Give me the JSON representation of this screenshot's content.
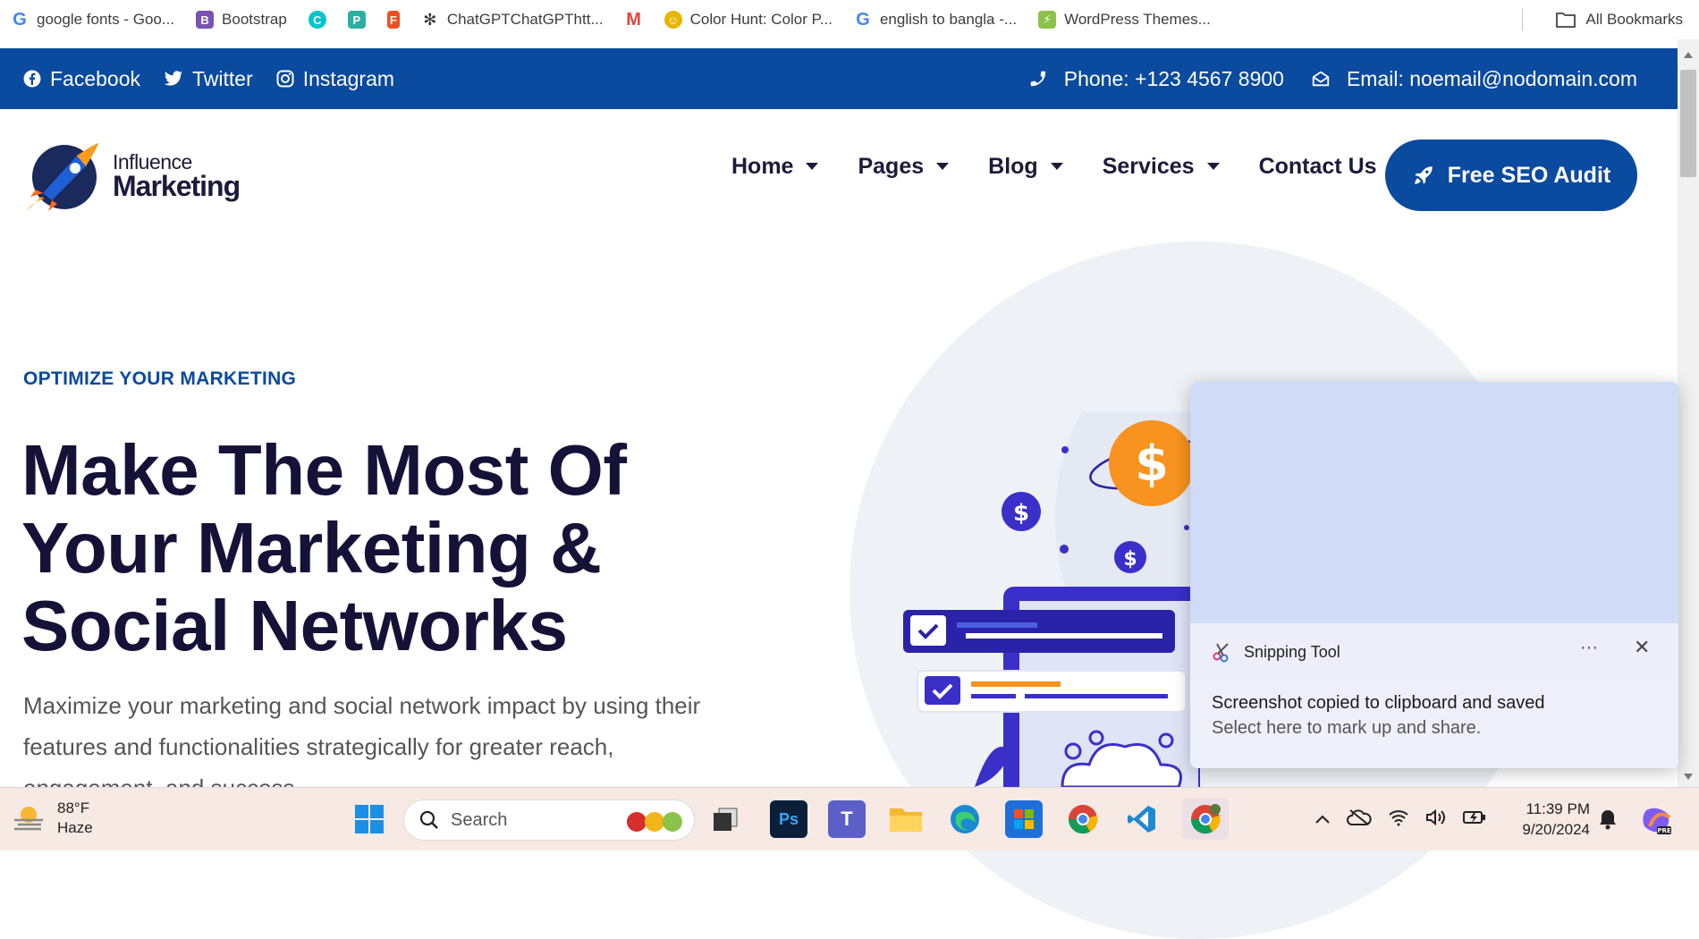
{
  "bookmarks": {
    "items": [
      {
        "label": "google fonts - Goo...",
        "icon": "google-icon",
        "color": "#4285f4"
      },
      {
        "label": "Bootstrap",
        "icon": "bootstrap-icon",
        "color": "#7952b3"
      },
      {
        "label": "",
        "icon": "canva-icon",
        "color": "#00c4cc"
      },
      {
        "label": "",
        "icon": "pdf-icon",
        "color": "#2bb0a0"
      },
      {
        "label": "",
        "icon": "figma-icon",
        "color": "#f24e1e"
      },
      {
        "label": "ChatGPTChatGPThtt...",
        "icon": "chatgpt-icon",
        "color": "#333333"
      },
      {
        "label": "",
        "icon": "gmail-icon",
        "color": "#ea4335"
      },
      {
        "label": "Color Hunt: Color P...",
        "icon": "colorhunt-icon",
        "color": "#e8b400"
      },
      {
        "label": "english to bangla -...",
        "icon": "google-icon",
        "color": "#4285f4"
      },
      {
        "label": "WordPress Themes...",
        "icon": "wordpress-icon",
        "color": "#8bc34a"
      }
    ],
    "all_bookmarks": "All Bookmarks"
  },
  "topbar": {
    "social": [
      {
        "label": "Facebook",
        "icon": "facebook-icon"
      },
      {
        "label": "Twitter",
        "icon": "twitter-icon"
      },
      {
        "label": "Instagram",
        "icon": "instagram-icon"
      }
    ],
    "phone": "Phone: +123 4567 8900",
    "email": "Email: noemail@nodomain.com",
    "bg_color": "#0a4a9f"
  },
  "nav": {
    "logo_line1": "Influence",
    "logo_line2": "Marketing",
    "menu": [
      {
        "label": "Home",
        "dropdown": true
      },
      {
        "label": "Pages",
        "dropdown": true
      },
      {
        "label": "Blog",
        "dropdown": true
      },
      {
        "label": "Services",
        "dropdown": true
      },
      {
        "label": "Contact Us",
        "dropdown": false
      }
    ],
    "cta": "Free SEO Audit"
  },
  "hero": {
    "eyebrow": "OPTIMIZE YOUR MARKETING",
    "headline_1": "Make The Most Of",
    "headline_2": "Your Marketing &",
    "headline_3": "Social Networks",
    "paragraph_1": "Maximize your marketing and social network impact by using their",
    "paragraph_2": "features and functionalities strategically for greater reach,",
    "paragraph_3": "engagement, and success."
  },
  "toast": {
    "app": "Snipping Tool",
    "more": "···",
    "close": "✕",
    "message": "Screenshot copied to clipboard and saved",
    "sub": "Select here to mark up and share."
  },
  "taskbar": {
    "temperature": "88°F",
    "condition": "Haze",
    "search_placeholder": "Search",
    "time": "11:39 PM",
    "date": "9/20/2024",
    "apps": [
      "start-icon",
      "task-view-icon",
      "photoshop-icon",
      "teams-icon",
      "file-explorer-icon",
      "edge-icon",
      "store-icon",
      "chrome-icon",
      "vscode-icon",
      "chrome-profile-icon"
    ]
  }
}
